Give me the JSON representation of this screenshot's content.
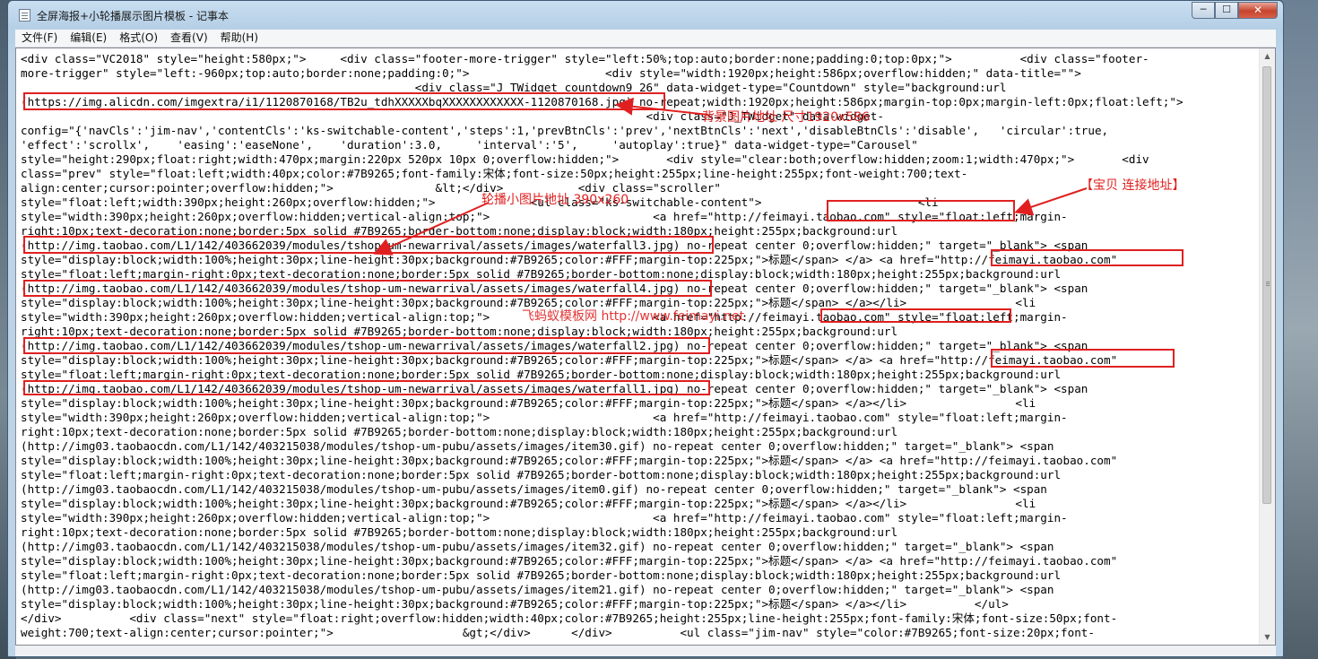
{
  "window": {
    "title": "全屏海报+小轮播展示图片模板 - 记事本",
    "controls": {
      "minimize": "─",
      "maximize": "☐",
      "close": "✕"
    }
  },
  "menu": [
    "文件(F)",
    "编辑(E)",
    "格式(O)",
    "查看(V)",
    "帮助(H)"
  ],
  "editor": {
    "lines": [
      "<div class=\"VC2018\" style=\"height:580px;\">     <div class=\"footer-more-trigger\" style=\"left:50%;top:auto;border:none;padding:0;top:0px;\">          <div class=\"footer-",
      "more-trigger\" style=\"left:-960px;top:auto;border:none;padding:0;\">                    <div style=\"width:1920px;height:586px;overflow:hidden;\" data-title=\"\">",
      "                                                          <div class=\"J_TWidget countdown9_26\" data-widget-type=\"Countdown\" style=\"background:url",
      "(https://img.alicdn.com/imgextra/i1/1120870168/TB2u_tdhXXXXXbqXXXXXXXXXXXX-1120870168.jpg) no-repeat;width:1920px;height:586px;margin-top:0px;margin-left:0px;float:left;\">",
      "                                                                                            <div class=\"J_TWidget\" data-widget-",
      "config=\"{'navCls':'jim-nav','contentCls':'ks-switchable-content','steps':1,'prevBtnCls':'prev','nextBtnCls':'next','disableBtnCls':'disable',   'circular':true,",
      "'effect':'scrollx',    'easing':'easeNone',    'duration':3.0,     'interval':'5',     'autoplay':true}\" data-widget-type=\"Carousel\"",
      "style=\"height:290px;float:right;width:470px;margin:220px 520px 10px 0;overflow:hidden;\">       <div style=\"clear:both;overflow:hidden;zoom:1;width:470px;\">       <div",
      "class=\"prev\" style=\"float:left;width:40px;color:#7B9265;font-family:宋体;font-size:50px;height:255px;line-height:255px;font-weight:700;text-",
      "align:center;cursor:pointer;overflow:hidden;\">               &lt;</div>           <div class=\"scroller\"",
      "style=\"float:left;width:390px;height:260px;overflow:hidden;\">              <ul class=\"ks-switchable-content\">                       <li",
      "style=\"width:390px;height:260px;overflow:hidden;vertical-align:top;\">                        <a href=\"http://feimayi.taobao.com\" style=\"float:left;margin-",
      "right:10px;text-decoration:none;border:5px solid #7B9265;border-bottom:none;display:block;width:180px;height:255px;background:url",
      "(http://img.taobao.com/L1/142/403662039/modules/tshop-um-newarrival/assets/images/waterfall3.jpg) no-repeat center 0;overflow:hidden;\" target=\"_blank\"> <span",
      "style=\"display:block;width:100%;height:30px;line-height:30px;background:#7B9265;color:#FFF;margin-top:225px;\">标题</span> </a> <a href=\"http://feimayi.taobao.com\"",
      "style=\"float:left;margin-right:0px;text-decoration:none;border:5px solid #7B9265;border-bottom:none;display:block;width:180px;height:255px;background:url",
      "(http://img.taobao.com/L1/142/403662039/modules/tshop-um-newarrival/assets/images/waterfall4.jpg) no-repeat center 0;overflow:hidden;\" target=\"_blank\"> <span",
      "style=\"display:block;width:100%;height:30px;line-height:30px;background:#7B9265;color:#FFF;margin-top:225px;\">标题</span> </a></li>                <li",
      "style=\"width:390px;height:260px;overflow:hidden;vertical-align:top;\">                        <a href=\"http://feimayi.taobao.com\" style=\"float:left;margin-",
      "right:10px;text-decoration:none;border:5px solid #7B9265;border-bottom:none;display:block;width:180px;height:255px;background:url",
      "(http://img.taobao.com/L1/142/403662039/modules/tshop-um-newarrival/assets/images/waterfall2.jpg) no-repeat center 0;overflow:hidden;\" target=\"_blank\"> <span",
      "style=\"display:block;width:100%;height:30px;line-height:30px;background:#7B9265;color:#FFF;margin-top:225px;\">标题</span> </a> <a href=\"http://feimayi.taobao.com\"",
      "style=\"float:left;margin-right:0px;text-decoration:none;border:5px solid #7B9265;border-bottom:none;display:block;width:180px;height:255px;background:url",
      "(http://img.taobao.com/L1/142/403662039/modules/tshop-um-newarrival/assets/images/waterfall1.jpg) no-repeat center 0;overflow:hidden;\" target=\"_blank\"> <span",
      "style=\"display:block;width:100%;height:30px;line-height:30px;background:#7B9265;color:#FFF;margin-top:225px;\">标题</span> </a></li>                <li",
      "style=\"width:390px;height:260px;overflow:hidden;vertical-align:top;\">                        <a href=\"http://feimayi.taobao.com\" style=\"float:left;margin-",
      "right:10px;text-decoration:none;border:5px solid #7B9265;border-bottom:none;display:block;width:180px;height:255px;background:url",
      "(http://img03.taobaocdn.com/L1/142/403215038/modules/tshop-um-pubu/assets/images/item30.gif) no-repeat center 0;overflow:hidden;\" target=\"_blank\"> <span",
      "style=\"display:block;width:100%;height:30px;line-height:30px;background:#7B9265;color:#FFF;margin-top:225px;\">标题</span> </a> <a href=\"http://feimayi.taobao.com\"",
      "style=\"float:left;margin-right:0px;text-decoration:none;border:5px solid #7B9265;border-bottom:none;display:block;width:180px;height:255px;background:url",
      "(http://img03.taobaocdn.com/L1/142/403215038/modules/tshop-um-pubu/assets/images/item0.gif) no-repeat center 0;overflow:hidden;\" target=\"_blank\"> <span",
      "style=\"display:block;width:100%;height:30px;line-height:30px;background:#7B9265;color:#FFF;margin-top:225px;\">标题</span> </a></li>                <li",
      "style=\"width:390px;height:260px;overflow:hidden;vertical-align:top;\">                        <a href=\"http://feimayi.taobao.com\" style=\"float:left;margin-",
      "right:10px;text-decoration:none;border:5px solid #7B9265;border-bottom:none;display:block;width:180px;height:255px;background:url",
      "(http://img03.taobaocdn.com/L1/142/403215038/modules/tshop-um-pubu/assets/images/item32.gif) no-repeat center 0;overflow:hidden;\" target=\"_blank\"> <span",
      "style=\"display:block;width:100%;height:30px;line-height:30px;background:#7B9265;color:#FFF;margin-top:225px;\">标题</span> </a> <a href=\"http://feimayi.taobao.com\"",
      "style=\"float:left;margin-right:0px;text-decoration:none;border:5px solid #7B9265;border-bottom:none;display:block;width:180px;height:255px;background:url",
      "(http://img03.taobaocdn.com/L1/142/403215038/modules/tshop-um-pubu/assets/images/item21.gif) no-repeat center 0;overflow:hidden;\" target=\"_blank\"> <span",
      "style=\"display:block;width:100%;height:30px;line-height:30px;background:#7B9265;color:#FFF;margin-top:225px;\">标题</span> </a></li>          </ul>",
      "</div>          <div class=\"next\" style=\"float:right;overflow:hidden;width:40px;color:#7B9265;height:255px;line-height:255px;font-family:宋体;font-size:50px;font-",
      "weight:700;text-align:center;cursor:pointer;\">                   &gt;</div>      </div>          <ul class=\"jim-nav\" style=\"color:#7B9265;font-size:20px;font-"
    ]
  },
  "annotations": {
    "bg_image": "背景图片地址 尺寸1920x586",
    "carousel_image": "轮播小图片地址 390x260",
    "item_link": "【宝贝 连接地址】",
    "watermark": "飞蚂蚁模板网 http://www.feimayi.net"
  },
  "colors": {
    "annotation": "#e02020",
    "title_bar": "#bcd3e8"
  }
}
